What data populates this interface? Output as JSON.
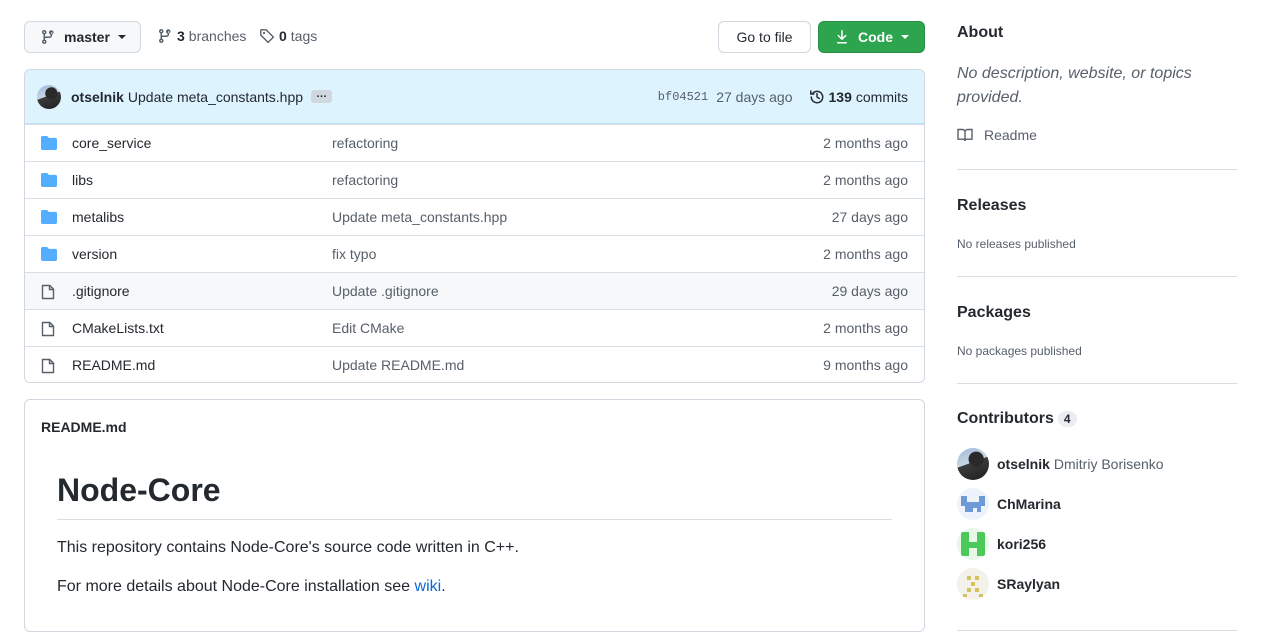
{
  "toolbar": {
    "branch": "master",
    "branches_count": "3",
    "branches_label": "branches",
    "tags_count": "0",
    "tags_label": "tags",
    "go_to_file": "Go to file",
    "code": "Code"
  },
  "latest_commit": {
    "author": "otselnik",
    "message": "Update meta_constants.hpp",
    "ellipsis": "…",
    "sha": "bf04521",
    "age": "27 days ago",
    "commits_count": "139",
    "commits_label": "commits"
  },
  "files": [
    {
      "type": "folder",
      "name": "core_service",
      "message": "refactoring",
      "age": "2 months ago"
    },
    {
      "type": "folder",
      "name": "libs",
      "message": "refactoring",
      "age": "2 months ago"
    },
    {
      "type": "folder",
      "name": "metalibs",
      "message": "Update meta_constants.hpp",
      "age": "27 days ago"
    },
    {
      "type": "folder",
      "name": "version",
      "message": "fix typo",
      "age": "2 months ago"
    },
    {
      "type": "file",
      "name": ".gitignore",
      "message": "Update .gitignore",
      "age": "29 days ago"
    },
    {
      "type": "file",
      "name": "CMakeLists.txt",
      "message": "Edit CMake",
      "age": "2 months ago"
    },
    {
      "type": "file",
      "name": "README.md",
      "message": "Update README.md",
      "age": "9 months ago"
    }
  ],
  "readme": {
    "filename": "README.md",
    "title": "Node-Core",
    "p1": "This repository contains Node-Core's source code written in C++.",
    "p2_prefix": "For more details about Node-Core installation see ",
    "p2_link": "wiki",
    "p2_suffix": "."
  },
  "sidebar": {
    "about_title": "About",
    "about_desc": "No description, website, or topics provided.",
    "readme_link": "Readme",
    "releases_title": "Releases",
    "releases_note": "No releases published",
    "packages_title": "Packages",
    "packages_note": "No packages published",
    "contributors_title": "Contributors",
    "contributors_count": "4",
    "contributors": [
      {
        "login": "otselnik",
        "name": "Dmitriy Borisenko"
      },
      {
        "login": "ChMarina",
        "name": ""
      },
      {
        "login": "kori256",
        "name": ""
      },
      {
        "login": "SRaylyan",
        "name": ""
      }
    ]
  },
  "colors": {
    "accent_green": "#2da44e",
    "link_blue": "#0969da",
    "folder_blue": "#54aeff",
    "commit_bar": "#ddf4ff"
  }
}
